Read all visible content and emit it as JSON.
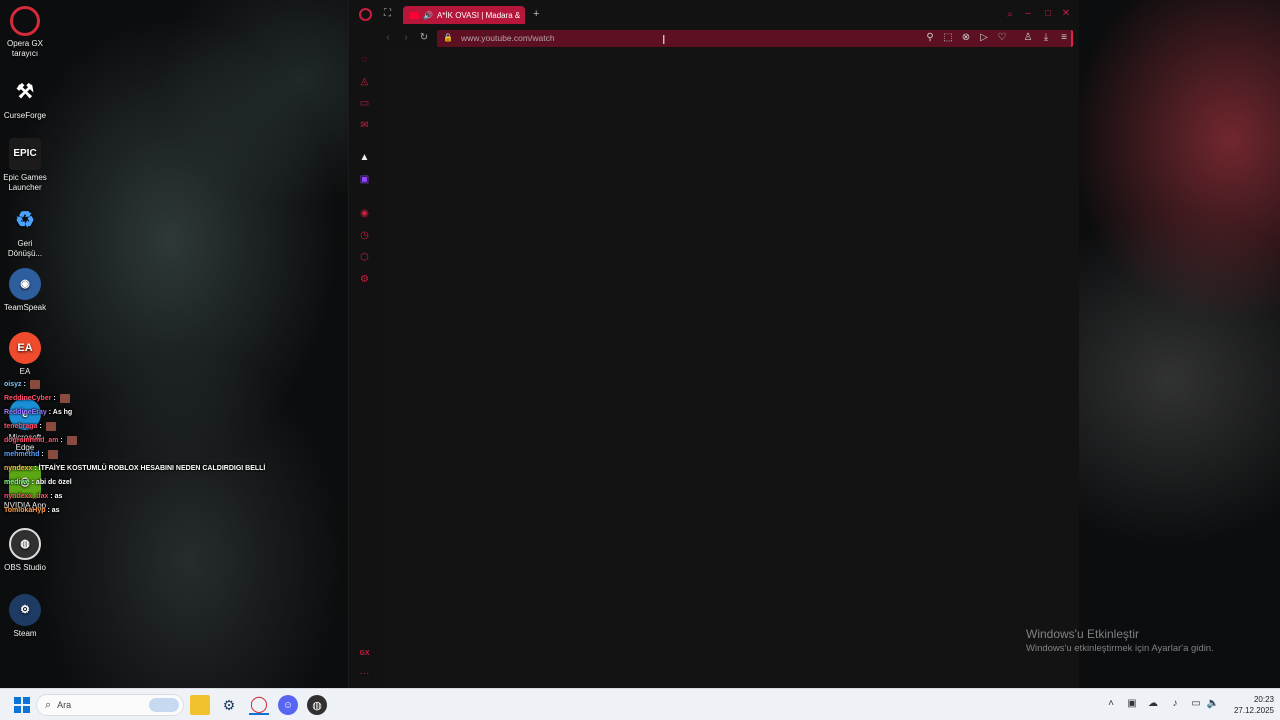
{
  "desktop": {
    "icons": [
      {
        "name": "opera-gx-desktop-icon",
        "label": "Opera GX\ntarayıcı",
        "icon": "opera-gx-icon",
        "color": "#d42b3a",
        "glyph": "O"
      },
      {
        "name": "curseforge-desktop-icon",
        "label": "CurseForge",
        "icon": "curseforge-icon",
        "color": "#2a2a2a",
        "glyph": "⚒"
      },
      {
        "name": "epic-games-desktop-icon",
        "label": "Epic Games\nLauncher",
        "icon": "epic-games-icon",
        "color": "#1b1b1b",
        "glyph": "EPIC"
      },
      {
        "name": "recycle-bin-desktop-icon",
        "label": "Geri\nDönüşü...",
        "icon": "recycle-bin-icon",
        "color": "#3b7bd6",
        "glyph": "♻"
      },
      {
        "name": "teamspeak-desktop-icon",
        "label": "TeamSpeak",
        "icon": "teamspeak-icon",
        "color": "#2f5e9e",
        "glyph": "◉"
      },
      {
        "name": "ea-desktop-icon",
        "label": "EA",
        "icon": "ea-icon",
        "color": "#ef4b2c",
        "glyph": "EA"
      },
      {
        "name": "edge-desktop-icon",
        "label": "Microsoft\nEdge",
        "icon": "edge-icon",
        "color": "#1b8fd6",
        "glyph": "e"
      },
      {
        "name": "nvidia-desktop-icon",
        "label": "NVIDIA App",
        "icon": "nvidia-icon",
        "color": "#5aa614",
        "glyph": "◎"
      },
      {
        "name": "obs-desktop-icon",
        "label": "OBS Studio",
        "icon": "obs-icon",
        "color": "#303030",
        "glyph": "◍"
      },
      {
        "name": "steam-desktop-icon",
        "label": "Steam",
        "icon": "steam-icon",
        "color": "#1d3b63",
        "glyph": "⚙"
      }
    ]
  },
  "chat": {
    "lines": [
      {
        "user": "oisyz",
        "user_color": "#7ec8ff",
        "msg": "",
        "emote": true
      },
      {
        "user": "ReddineCyber",
        "user_color": "#ff4f6a",
        "msg": "",
        "emote": true
      },
      {
        "user": "ReddineEray",
        "user_color": "#9b7bff",
        "msg": "As hg",
        "emote": false
      },
      {
        "user": "tenebraga",
        "user_color": "#ff4f6a",
        "msg": "",
        "emote": true
      },
      {
        "user": "dogramhmd_am",
        "user_color": "#ff4f6a",
        "msg": "",
        "emote": true
      },
      {
        "user": "mehmethd",
        "user_color": "#5aa0ff",
        "msg": "",
        "emote": true
      },
      {
        "user": "nyndexx",
        "user_color": "#ffb347",
        "msg": "İTFAİYE KOSTUMLÜ ROBLOX HESABINI NEDEN CALDIRDIGI BELLİ",
        "emote": false
      },
      {
        "user": "mediwe",
        "user_color": "#8cff8c",
        "msg": "abi dc özel",
        "emote": false
      },
      {
        "user": "nyndexx_dax",
        "user_color": "#ff4f6a",
        "msg": "as",
        "emote": false
      },
      {
        "user": "TomiokaHyp",
        "user_color": "#ffa24d",
        "msg": "as",
        "emote": false
      }
    ]
  },
  "browser": {
    "tab_title": "A*İK OVASI | Madara &",
    "url": "www.youtube.com/watch",
    "accent": "#c81e42"
  },
  "watermark": {
    "title": "Windows'u Etkinleştir",
    "subtitle": "Windows'u etkinleştirmek için Ayarlar'a gidin."
  },
  "taskbar": {
    "search_placeholder": "Ara",
    "time": "20:23",
    "date": "27.12.2025"
  }
}
